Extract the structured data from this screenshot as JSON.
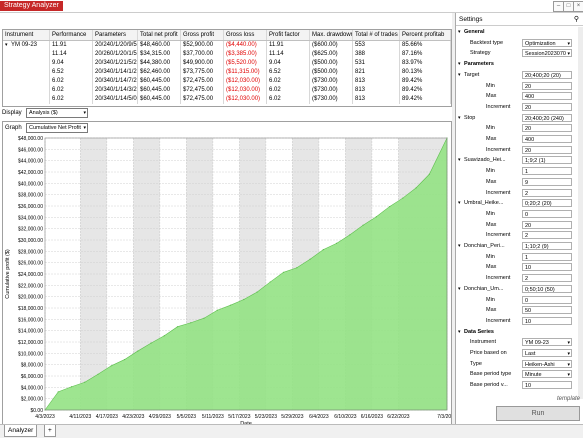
{
  "window": {
    "title": "Strategy Analyzer",
    "extra": "  "
  },
  "grid": {
    "headers": [
      "Instrument",
      "Performance",
      "Parameters",
      "Total net profit",
      "Gross profit",
      "Gross loss",
      "Profit factor",
      "Max. drawdown",
      "Total # of trades",
      "Percent profitab"
    ],
    "rows": [
      [
        "YM 09-23",
        "11.91",
        "20/240/1/20/9/5",
        "$48,460.00",
        "$52,900.00",
        "($4,440.00)",
        "11.91",
        "($600.00)",
        "553",
        "85.66%"
      ],
      [
        "",
        "11.14",
        "20/260/1/20/1/5",
        "$34,315.00",
        "$37,700.00",
        "($3,385.00)",
        "11.14",
        "($625.00)",
        "388",
        "87.16%"
      ],
      [
        "",
        "9.04",
        "20/340/1/21/5/2",
        "$44,380.00",
        "$49,900.00",
        "($5,520.00)",
        "9.04",
        "($500.00)",
        "531",
        "83.97%"
      ],
      [
        "",
        "6.52",
        "20/340/1/14/1/2",
        "$62,460.00",
        "$73,775.00",
        "($11,315.00)",
        "6.52",
        "($500.00)",
        "821",
        "80.13%"
      ],
      [
        "",
        "6.02",
        "20/340/1/14/7/2",
        "$60,445.00",
        "$72,475.00",
        "($12,030.00)",
        "6.02",
        "($730.00)",
        "813",
        "89.42%"
      ],
      [
        "",
        "6.02",
        "20/340/1/14/3/2",
        "$60,445.00",
        "$72,475.00",
        "($12,030.00)",
        "6.02",
        "($730.00)",
        "813",
        "89.42%"
      ],
      [
        "",
        "6.02",
        "20/340/1/14/5/0",
        "$60,445.00",
        "$72,475.00",
        "($12,030.00)",
        "6.02",
        "($730.00)",
        "813",
        "89.42%"
      ]
    ]
  },
  "display": {
    "label": "Display",
    "value": "Analysis ($)"
  },
  "graph": {
    "label": "Graph",
    "value": "Cumulative Net Profit"
  },
  "chart_data": {
    "type": "area",
    "title": "",
    "xlabel": "Date",
    "ylabel": "Cumulative profit ($)",
    "ylim": [
      0,
      48000
    ],
    "yticks": [
      "$0.00",
      "$2,000.00",
      "$4,000.00",
      "$6,000.00",
      "$8,000.00",
      "$10,000.00",
      "$12,000.00",
      "$14,000.00",
      "$16,000.00",
      "$18,000.00",
      "$20,000.00",
      "$22,000.00",
      "$24,000.00",
      "$26,000.00",
      "$28,000.00",
      "$30,000.00",
      "$32,000.00",
      "$34,000.00",
      "$36,000.00",
      "$38,000.00",
      "$40,000.00",
      "$42,000.00",
      "$44,000.00",
      "$46,000.00",
      "$48,000.00"
    ],
    "xticks": [
      "4/3/2023",
      "4/11/2023",
      "4/17/2023",
      "4/23/2023",
      "4/29/2023",
      "5/5/2023",
      "5/11/2023",
      "5/17/2023",
      "5/23/2023",
      "5/29/2023",
      "6/4/2023",
      "6/10/2023",
      "6/16/2023",
      "6/22/2023",
      "7/3/2023"
    ],
    "x": [
      "4/3/2023",
      "4/6/2023",
      "4/9/2023",
      "4/12/2023",
      "4/15/2023",
      "4/18/2023",
      "4/21/2023",
      "4/24/2023",
      "4/27/2023",
      "4/30/2023",
      "5/3/2023",
      "5/6/2023",
      "5/9/2023",
      "5/12/2023",
      "5/15/2023",
      "5/18/2023",
      "5/21/2023",
      "5/24/2023",
      "5/27/2023",
      "5/30/2023",
      "6/2/2023",
      "6/5/2023",
      "6/8/2023",
      "6/11/2023",
      "6/14/2023",
      "6/17/2023",
      "6/20/2023",
      "6/23/2023",
      "6/26/2023",
      "6/29/2023",
      "7/3/2023"
    ],
    "series": [
      {
        "values": [
          0,
          3200,
          4100,
          4900,
          6300,
          7800,
          8900,
          10400,
          11800,
          13100,
          14700,
          15400,
          16200,
          17600,
          18500,
          19500,
          20800,
          22600,
          24300,
          25100,
          26600,
          28300,
          29400,
          30900,
          32600,
          34100,
          35900,
          37400,
          39200,
          41600,
          48000
        ],
        "color": "#94e284"
      }
    ],
    "grid": true,
    "shaded_bands": true
  },
  "tabs": [
    {
      "label": "Analyzer"
    },
    {
      "label": "+"
    }
  ],
  "settings": {
    "title": "Settings",
    "pin_icon": "pin-icon",
    "rows": [
      {
        "type": "cat",
        "label": "General"
      },
      {
        "type": "prop",
        "label": "Backtest type",
        "value": "Optimization",
        "dd": true
      },
      {
        "type": "prop",
        "label": "Strategy",
        "value": "Session2023070",
        "dd": true
      },
      {
        "type": "cat",
        "label": "Parameters"
      },
      {
        "type": "grp",
        "label": "Target",
        "value": "20;400;20 (20)"
      },
      {
        "type": "sub",
        "label": "Min",
        "value": "20"
      },
      {
        "type": "sub",
        "label": "Max",
        "value": "400"
      },
      {
        "type": "sub",
        "label": "Increment",
        "value": "20"
      },
      {
        "type": "grp",
        "label": "Stop",
        "value": "20;400;20 (240)"
      },
      {
        "type": "sub",
        "label": "Min",
        "value": "20"
      },
      {
        "type": "sub",
        "label": "Max",
        "value": "400"
      },
      {
        "type": "sub",
        "label": "Increment",
        "value": "20"
      },
      {
        "type": "grp",
        "label": "Suavizado_Hei...",
        "value": "1;9;2 (1)"
      },
      {
        "type": "sub",
        "label": "Min",
        "value": "1"
      },
      {
        "type": "sub",
        "label": "Max",
        "value": "9"
      },
      {
        "type": "sub",
        "label": "Increment",
        "value": "2"
      },
      {
        "type": "grp",
        "label": "Umbral_Heike...",
        "value": "0;20;2 (20)"
      },
      {
        "type": "sub",
        "label": "Min",
        "value": "0"
      },
      {
        "type": "sub",
        "label": "Max",
        "value": "20"
      },
      {
        "type": "sub",
        "label": "Increment",
        "value": "2"
      },
      {
        "type": "grp",
        "label": "Donchian_Peri...",
        "value": "1;10;2 (9)"
      },
      {
        "type": "sub",
        "label": "Min",
        "value": "1"
      },
      {
        "type": "sub",
        "label": "Max",
        "value": "10"
      },
      {
        "type": "sub",
        "label": "Increment",
        "value": "2"
      },
      {
        "type": "grp",
        "label": "Donchian_Um...",
        "value": "0;50;10 (50)"
      },
      {
        "type": "sub",
        "label": "Min",
        "value": "0"
      },
      {
        "type": "sub",
        "label": "Max",
        "value": "50"
      },
      {
        "type": "sub",
        "label": "Increment",
        "value": "10"
      },
      {
        "type": "cat",
        "label": "Data Series"
      },
      {
        "type": "prop",
        "label": "Instrument",
        "value": "YM 09-23",
        "dd": true
      },
      {
        "type": "prop",
        "label": "Price based on",
        "value": "Last",
        "dd": true
      },
      {
        "type": "prop",
        "label": "Type",
        "value": "Heiken-Ashi",
        "dd": true
      },
      {
        "type": "prop",
        "label": "Base period type",
        "value": "Minute",
        "dd": true
      },
      {
        "type": "prop",
        "label": "Base period v...",
        "value": "10",
        "dd": false
      }
    ],
    "template_label": "template",
    "run_label": "Run"
  }
}
